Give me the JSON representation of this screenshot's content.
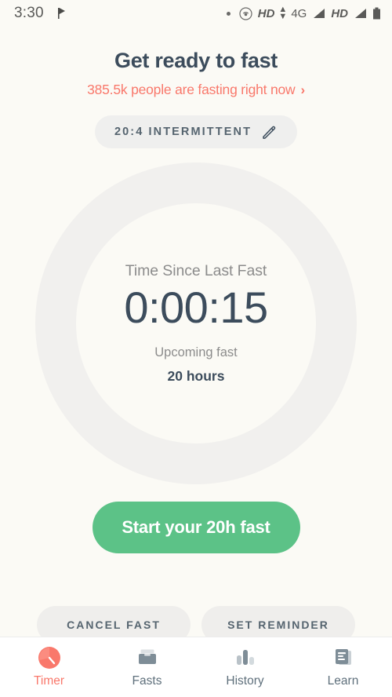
{
  "statusbar": {
    "time": "3:30",
    "flag_icon": "flag-icon",
    "dot_icon": "dot-icon",
    "hotspot_icon": "hotspot-icon",
    "hd_label_1": "HD",
    "data_arrows_icon": "data-transfer-arrows-icon",
    "network_label": "4G",
    "signal_icon_1": "signal-bars-icon",
    "hd_label_2": "HD",
    "signal_icon_2": "signal-bars-icon",
    "battery_icon": "battery-icon"
  },
  "header": {
    "title": "Get ready to fast",
    "subtitle": "385.5k people are fasting right now",
    "subtitle_chevron": "›"
  },
  "plan": {
    "label": "20:4 INTERMITTENT",
    "edit_icon": "pencil-icon"
  },
  "timer": {
    "since_label": "Time Since Last Fast",
    "elapsed": "0:00:15",
    "upcoming_label": "Upcoming fast",
    "upcoming_value": "20 hours"
  },
  "actions": {
    "start_label": "Start your 20h fast",
    "cancel_label": "CANCEL FAST",
    "reminder_label": "SET REMINDER"
  },
  "nav": {
    "items": [
      {
        "label": "Timer",
        "icon": "timer-clock-icon",
        "active": true
      },
      {
        "label": "Fasts",
        "icon": "archive-box-icon",
        "active": false
      },
      {
        "label": "History",
        "icon": "bar-chart-icon",
        "active": false
      },
      {
        "label": "Learn",
        "icon": "article-doc-icon",
        "active": false
      }
    ]
  },
  "colors": {
    "background": "#FBFAF5",
    "accent_coral": "#F9786B",
    "accent_green": "#5CC287",
    "text_dark": "#3C4C5C",
    "text_muted": "#8C8C8C",
    "ring": "#F1F0EE"
  }
}
